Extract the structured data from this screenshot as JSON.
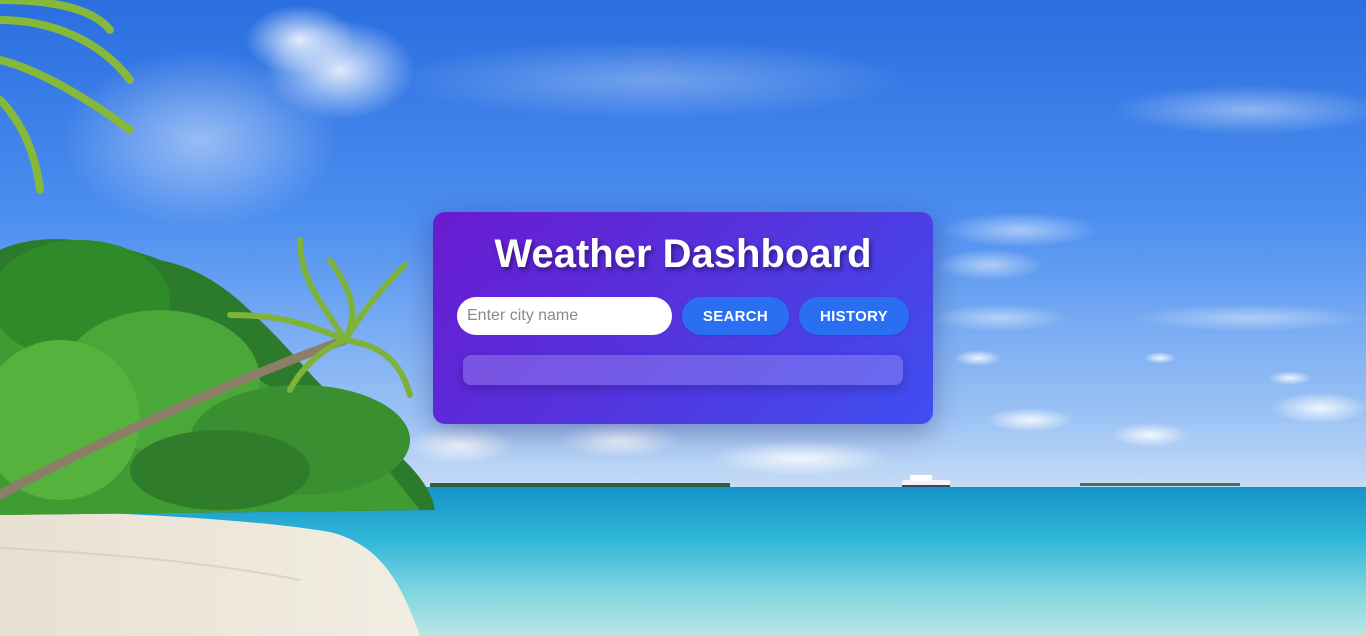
{
  "app": {
    "title": "Weather Dashboard"
  },
  "search": {
    "placeholder": "Enter city name",
    "value": "",
    "search_label": "SEARCH",
    "history_label": "HISTORY"
  },
  "result": {
    "text": ""
  },
  "colors": {
    "panel_start": "#6a1bd0",
    "panel_end": "#3f4ff0",
    "button": "#2a6ff2",
    "title_text": "#ffffff"
  }
}
